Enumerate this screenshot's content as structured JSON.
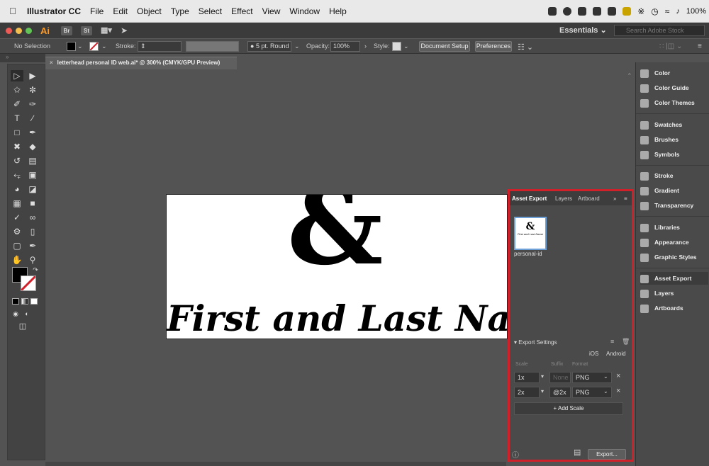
{
  "menubar": {
    "app_name": "Illustrator CC",
    "items": [
      "File",
      "Edit",
      "Object",
      "Type",
      "Select",
      "Effect",
      "View",
      "Window",
      "Help"
    ],
    "battery": "100%"
  },
  "appbar": {
    "logo": "Ai",
    "bridge": "Br",
    "stock": "St",
    "workspace": "Essentials",
    "search_placeholder": "Search Adobe Stock"
  },
  "control_bar": {
    "selection": "No Selection",
    "stroke_label": "Stroke:",
    "brush": "5 pt. Round",
    "opacity_label": "Opacity:",
    "opacity_value": "100%",
    "style_label": "Style:",
    "document_setup": "Document Setup",
    "preferences": "Preferences"
  },
  "document": {
    "tab_title": "letterhead personal ID web.ai* @ 300% (CMYK/GPU Preview)",
    "ampersand": "&",
    "name_text": "First and Last Name"
  },
  "asset_panel": {
    "tabs": [
      "Asset Export",
      "Layers",
      "Artboard"
    ],
    "asset_label": "personal-id",
    "thumb_text": "First and Last Name",
    "export_settings": "Export Settings",
    "platforms": [
      "iOS",
      "Android"
    ],
    "headers": [
      "Scale",
      "Suffix",
      "Format"
    ],
    "rows": [
      {
        "scale": "1x",
        "suffix": "None",
        "format": "PNG"
      },
      {
        "scale": "2x",
        "suffix": "@2x",
        "format": "PNG"
      }
    ],
    "add_scale": "+ Add Scale",
    "export_button": "Export..."
  },
  "dock": {
    "items": [
      "Color",
      "Color Guide",
      "Color Themes",
      "Swatches",
      "Brushes",
      "Symbols",
      "Stroke",
      "Gradient",
      "Transparency",
      "Libraries",
      "Appearance",
      "Graphic Styles",
      "Asset Export",
      "Layers",
      "Artboards"
    ]
  },
  "colors": {
    "highlight": "#d0202a",
    "app_bg": "#535353",
    "panel_bg": "#4a4a4a"
  }
}
